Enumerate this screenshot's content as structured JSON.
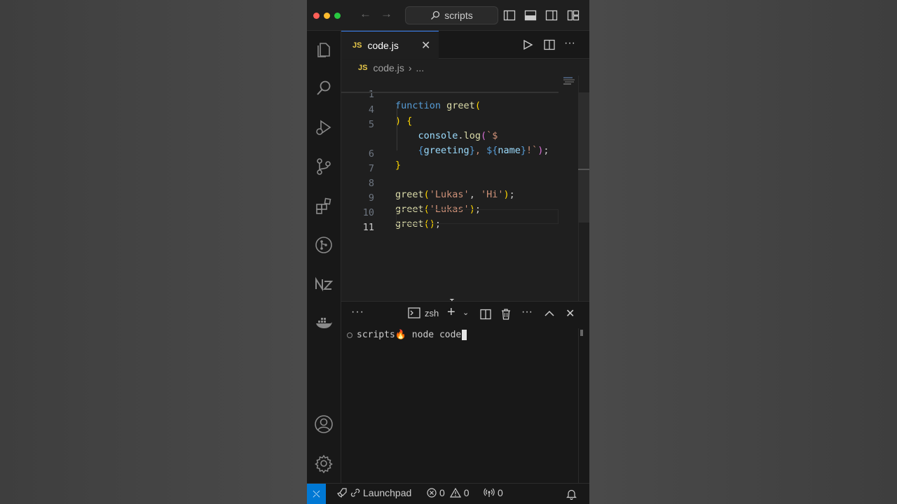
{
  "window": {
    "search_label": "scripts"
  },
  "editor": {
    "tab": {
      "badge": "JS",
      "label": "code.js"
    },
    "breadcrumb": {
      "badge": "JS",
      "file": "code.js",
      "separator": "›",
      "more": "..."
    },
    "lines": [
      {
        "num": "1"
      },
      {
        "num": "4"
      },
      {
        "num": "5"
      },
      {
        "num": ""
      },
      {
        "num": "6"
      },
      {
        "num": "7"
      },
      {
        "num": "8"
      },
      {
        "num": "9"
      },
      {
        "num": "10"
      },
      {
        "num": "11"
      }
    ],
    "code": {
      "l1_kw": "function",
      "l1_fn": "greet",
      "l1_br": "(",
      "l4_br1": ")",
      "l4_br2": "{",
      "l5_obj": "console",
      "l5_dot": ".",
      "l5_fn": "log",
      "l5_br": "(",
      "l5_tpl": "`$",
      "l5b_br": "{",
      "l5b_var": "greeting",
      "l5b_br2": "}",
      "l5b_str": ", ",
      "l5b_tpl": "${",
      "l5b_var2": "name",
      "l5b_tpl2": "}",
      "l5b_str2": "!`",
      "l5b_br3": ")",
      "l5b_semi": ";",
      "l6_br": "}",
      "l8_fn": "greet",
      "l8_br": "(",
      "l8_s1": "'Lukas'",
      "l8_c": ", ",
      "l8_s2": "'Hi'",
      "l8_br2": ")",
      "l8_semi": ";",
      "l9_fn": "greet",
      "l9_br": "(",
      "l9_s1": "'Lukas'",
      "l9_br2": ")",
      "l9_semi": ";",
      "l10_fn": "greet",
      "l10_br": "()",
      "l10_semi": ";"
    }
  },
  "panel": {
    "more": "···",
    "shell_label": "zsh",
    "prompt_dir": "scripts",
    "prompt_emoji": "🔥",
    "command": " node code"
  },
  "status": {
    "remote_glyph": "⤬",
    "launchpad_label": "Launchpad",
    "errors": "0",
    "warnings": "0",
    "ports": "0"
  },
  "colors": {
    "accent": "#0078d4",
    "js_badge": "#e8c94a"
  }
}
